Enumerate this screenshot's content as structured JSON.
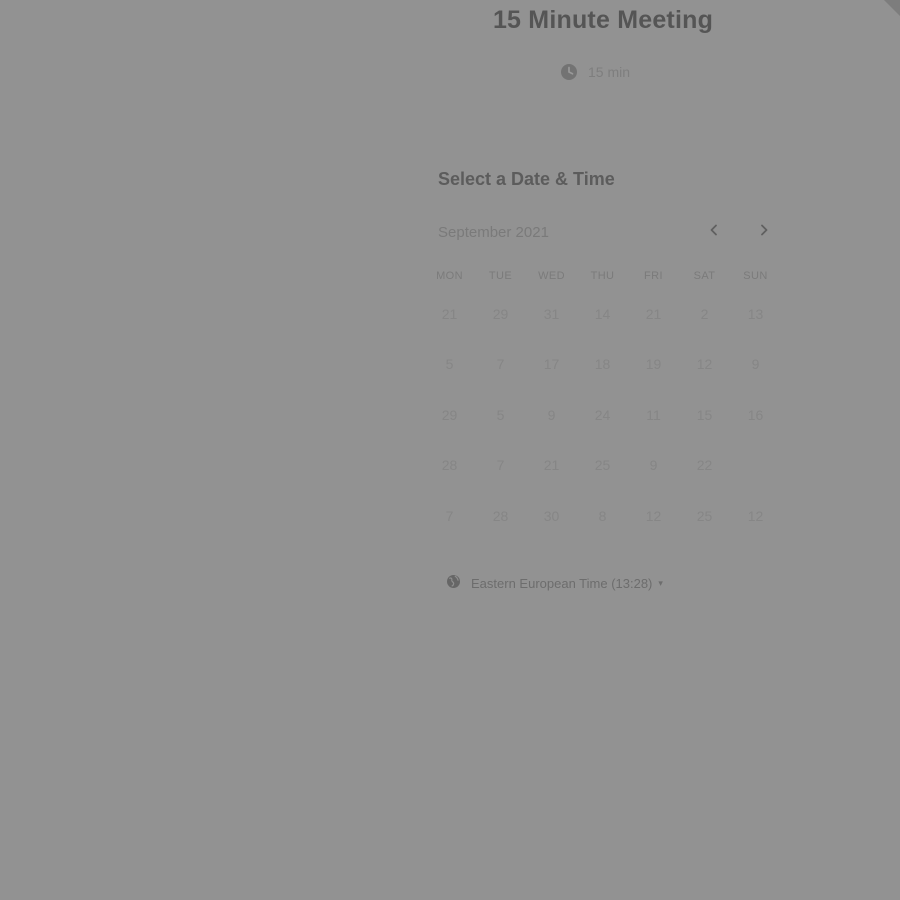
{
  "event": {
    "title": "15 Minute Meeting",
    "duration": "15 min",
    "duration_icon": "clock-icon"
  },
  "scheduler": {
    "heading": "Select a Date & Time",
    "month": "September 2021",
    "prev_icon": "chevron-left-icon",
    "next_icon": "chevron-right-icon",
    "weekdays": [
      "MON",
      "TUE",
      "WED",
      "THU",
      "FRI",
      "SAT",
      "SUN"
    ],
    "days": [
      "21",
      "29",
      "31",
      "14",
      "21",
      "2",
      "13",
      "5",
      "7",
      "17",
      "18",
      "19",
      "12",
      "9",
      "29",
      "5",
      "9",
      "24",
      "11",
      "15",
      "16",
      "28",
      "7",
      "21",
      "25",
      "9",
      "22",
      "",
      "7",
      "28",
      "30",
      "8",
      "12",
      "25",
      "12"
    ]
  },
  "timezone": {
    "label": "Eastern European Time (13:28)",
    "icon": "globe-icon",
    "caret": "▾"
  },
  "colors": {
    "overlay_background": "#929292",
    "title_text": "#555555",
    "muted_text": "#7a7a7a"
  }
}
